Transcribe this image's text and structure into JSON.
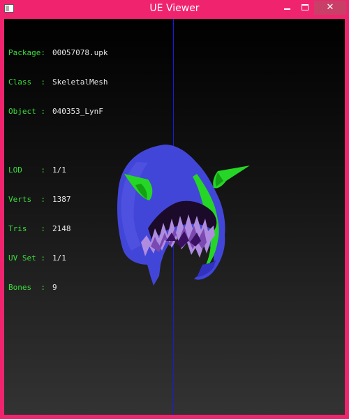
{
  "window": {
    "title": "UE Viewer"
  },
  "info": {
    "package_label": "Package:",
    "package_value": "00057078.upk",
    "class_label": "Class  :",
    "class_value": "SkeletalMesh",
    "object_label": "Object :",
    "object_value": "040353_LynF",
    "lod_label": "LOD    :",
    "lod_value": "1/1",
    "verts_label": "Verts  :",
    "verts_value": "1387",
    "tris_label": "Tris   :",
    "tris_value": "2148",
    "uvset_label": "UV Set :",
    "uvset_value": "1/1",
    "bones_label": "Bones  :",
    "bones_value": "9"
  },
  "colors": {
    "title_bar": "#f0246e",
    "label": "#3cde3c",
    "value": "#e6e6e6",
    "axis": "#1a1ae0",
    "mesh_blue": "#4040d8",
    "mesh_green": "#22d822",
    "mesh_purple": "#b48ce0"
  },
  "icons": {
    "app": "app-window-icon",
    "minimize": "minimize-icon",
    "maximize": "maximize-icon",
    "close": "close-icon"
  }
}
